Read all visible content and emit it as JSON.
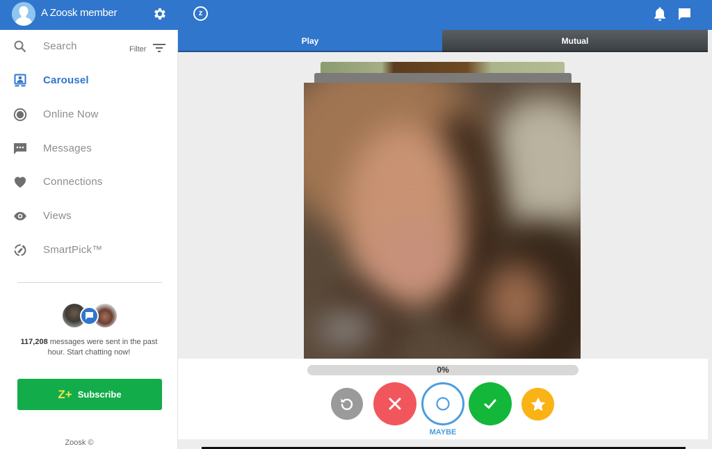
{
  "topbar": {
    "member_name": "A Zoosk member",
    "icons": [
      "user-avatar",
      "gear-icon",
      "zoosk-coin-icon",
      "bell-icon",
      "chat-icon"
    ],
    "brand_color": "#2f76cc"
  },
  "sidebar": {
    "search": {
      "label": "Search",
      "filter_label": "Filter"
    },
    "items": [
      {
        "label": "Carousel",
        "icon": "carousel-icon",
        "active": true
      },
      {
        "label": "Online Now",
        "icon": "online-icon",
        "active": false
      },
      {
        "label": "Messages",
        "icon": "messages-icon",
        "active": false
      },
      {
        "label": "Connections",
        "icon": "heart-icon",
        "active": false
      },
      {
        "label": "Views",
        "icon": "eye-icon",
        "active": false
      },
      {
        "label": "SmartPick™",
        "icon": "smartpick-icon",
        "active": false
      }
    ],
    "promo": {
      "count": "117,208",
      "text": " messages were sent in the past hour. Start chatting now!"
    },
    "subscribe": {
      "badge": "Z+",
      "label": "Subscribe",
      "color": "#12ad4a"
    },
    "copyright": "Zoosk ©"
  },
  "tabs": [
    {
      "label": "Play",
      "active": true
    },
    {
      "label": "Mutual",
      "active": false
    }
  ],
  "carousel": {
    "progress_percent": 0,
    "progress_label": "0%",
    "actions": [
      {
        "name": "undo",
        "color": "#9a9a9a"
      },
      {
        "name": "no",
        "color": "#f2565d"
      },
      {
        "name": "maybe",
        "color": "#4b9de0",
        "label": "MAYBE"
      },
      {
        "name": "yes",
        "color": "#13b73a"
      },
      {
        "name": "favorite",
        "color": "#fbb215"
      }
    ]
  }
}
